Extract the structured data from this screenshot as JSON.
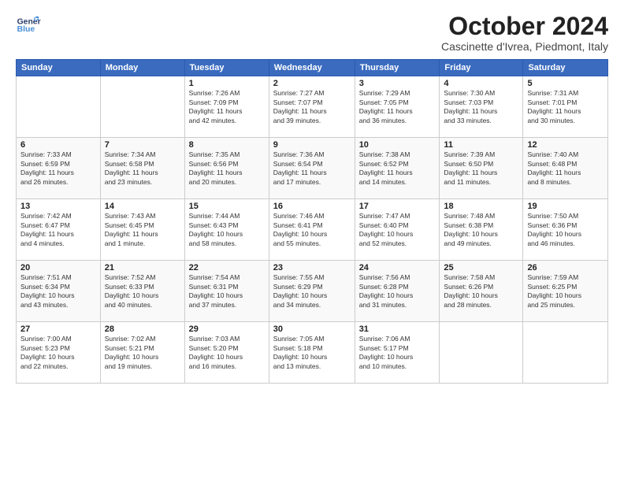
{
  "header": {
    "logo_general": "General",
    "logo_blue": "Blue",
    "month": "October 2024",
    "location": "Cascinette d'Ivrea, Piedmont, Italy"
  },
  "weekdays": [
    "Sunday",
    "Monday",
    "Tuesday",
    "Wednesday",
    "Thursday",
    "Friday",
    "Saturday"
  ],
  "weeks": [
    [
      {
        "day": "",
        "info": ""
      },
      {
        "day": "",
        "info": ""
      },
      {
        "day": "1",
        "info": "Sunrise: 7:26 AM\nSunset: 7:09 PM\nDaylight: 11 hours\nand 42 minutes."
      },
      {
        "day": "2",
        "info": "Sunrise: 7:27 AM\nSunset: 7:07 PM\nDaylight: 11 hours\nand 39 minutes."
      },
      {
        "day": "3",
        "info": "Sunrise: 7:29 AM\nSunset: 7:05 PM\nDaylight: 11 hours\nand 36 minutes."
      },
      {
        "day": "4",
        "info": "Sunrise: 7:30 AM\nSunset: 7:03 PM\nDaylight: 11 hours\nand 33 minutes."
      },
      {
        "day": "5",
        "info": "Sunrise: 7:31 AM\nSunset: 7:01 PM\nDaylight: 11 hours\nand 30 minutes."
      }
    ],
    [
      {
        "day": "6",
        "info": "Sunrise: 7:33 AM\nSunset: 6:59 PM\nDaylight: 11 hours\nand 26 minutes."
      },
      {
        "day": "7",
        "info": "Sunrise: 7:34 AM\nSunset: 6:58 PM\nDaylight: 11 hours\nand 23 minutes."
      },
      {
        "day": "8",
        "info": "Sunrise: 7:35 AM\nSunset: 6:56 PM\nDaylight: 11 hours\nand 20 minutes."
      },
      {
        "day": "9",
        "info": "Sunrise: 7:36 AM\nSunset: 6:54 PM\nDaylight: 11 hours\nand 17 minutes."
      },
      {
        "day": "10",
        "info": "Sunrise: 7:38 AM\nSunset: 6:52 PM\nDaylight: 11 hours\nand 14 minutes."
      },
      {
        "day": "11",
        "info": "Sunrise: 7:39 AM\nSunset: 6:50 PM\nDaylight: 11 hours\nand 11 minutes."
      },
      {
        "day": "12",
        "info": "Sunrise: 7:40 AM\nSunset: 6:48 PM\nDaylight: 11 hours\nand 8 minutes."
      }
    ],
    [
      {
        "day": "13",
        "info": "Sunrise: 7:42 AM\nSunset: 6:47 PM\nDaylight: 11 hours\nand 4 minutes."
      },
      {
        "day": "14",
        "info": "Sunrise: 7:43 AM\nSunset: 6:45 PM\nDaylight: 11 hours\nand 1 minute."
      },
      {
        "day": "15",
        "info": "Sunrise: 7:44 AM\nSunset: 6:43 PM\nDaylight: 10 hours\nand 58 minutes."
      },
      {
        "day": "16",
        "info": "Sunrise: 7:46 AM\nSunset: 6:41 PM\nDaylight: 10 hours\nand 55 minutes."
      },
      {
        "day": "17",
        "info": "Sunrise: 7:47 AM\nSunset: 6:40 PM\nDaylight: 10 hours\nand 52 minutes."
      },
      {
        "day": "18",
        "info": "Sunrise: 7:48 AM\nSunset: 6:38 PM\nDaylight: 10 hours\nand 49 minutes."
      },
      {
        "day": "19",
        "info": "Sunrise: 7:50 AM\nSunset: 6:36 PM\nDaylight: 10 hours\nand 46 minutes."
      }
    ],
    [
      {
        "day": "20",
        "info": "Sunrise: 7:51 AM\nSunset: 6:34 PM\nDaylight: 10 hours\nand 43 minutes."
      },
      {
        "day": "21",
        "info": "Sunrise: 7:52 AM\nSunset: 6:33 PM\nDaylight: 10 hours\nand 40 minutes."
      },
      {
        "day": "22",
        "info": "Sunrise: 7:54 AM\nSunset: 6:31 PM\nDaylight: 10 hours\nand 37 minutes."
      },
      {
        "day": "23",
        "info": "Sunrise: 7:55 AM\nSunset: 6:29 PM\nDaylight: 10 hours\nand 34 minutes."
      },
      {
        "day": "24",
        "info": "Sunrise: 7:56 AM\nSunset: 6:28 PM\nDaylight: 10 hours\nand 31 minutes."
      },
      {
        "day": "25",
        "info": "Sunrise: 7:58 AM\nSunset: 6:26 PM\nDaylight: 10 hours\nand 28 minutes."
      },
      {
        "day": "26",
        "info": "Sunrise: 7:59 AM\nSunset: 6:25 PM\nDaylight: 10 hours\nand 25 minutes."
      }
    ],
    [
      {
        "day": "27",
        "info": "Sunrise: 7:00 AM\nSunset: 5:23 PM\nDaylight: 10 hours\nand 22 minutes."
      },
      {
        "day": "28",
        "info": "Sunrise: 7:02 AM\nSunset: 5:21 PM\nDaylight: 10 hours\nand 19 minutes."
      },
      {
        "day": "29",
        "info": "Sunrise: 7:03 AM\nSunset: 5:20 PM\nDaylight: 10 hours\nand 16 minutes."
      },
      {
        "day": "30",
        "info": "Sunrise: 7:05 AM\nSunset: 5:18 PM\nDaylight: 10 hours\nand 13 minutes."
      },
      {
        "day": "31",
        "info": "Sunrise: 7:06 AM\nSunset: 5:17 PM\nDaylight: 10 hours\nand 10 minutes."
      },
      {
        "day": "",
        "info": ""
      },
      {
        "day": "",
        "info": ""
      }
    ]
  ]
}
